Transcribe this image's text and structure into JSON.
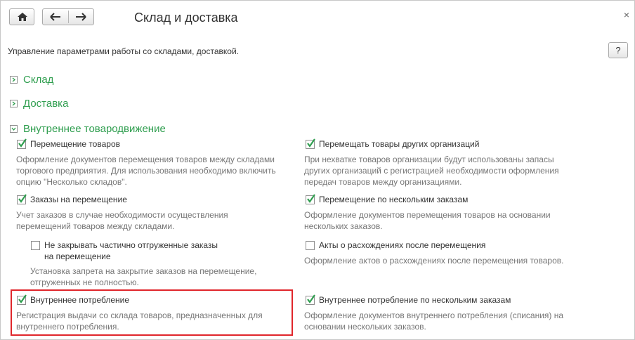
{
  "window": {
    "title": "Склад и доставка",
    "close_glyph": "×",
    "description": "Управление параметрами работы со складами, доставкой.",
    "help_label": "?"
  },
  "toolbar": {
    "home_icon": "home-icon",
    "back_icon": "arrow-left-icon",
    "forward_icon": "arrow-right-icon"
  },
  "groups": [
    {
      "title": "Склад",
      "expanded": false
    },
    {
      "title": "Доставка",
      "expanded": false
    },
    {
      "title": "Внутреннее товародвижение",
      "expanded": true
    }
  ],
  "options": {
    "transfer": {
      "label": "Перемещение товаров",
      "checked": true,
      "note1": "Оформление документов перемещения товаров между складами",
      "note2": "торгового предприятия. Для использования необходимо включить",
      "note3": "опцию \"Несколько складов\"."
    },
    "transfer_orders": {
      "label": "Заказы на перемещение",
      "checked": true,
      "note1": "Учет заказов в случае необходимости осуществления",
      "note2": "перемещений товаров между складами."
    },
    "no_close_orders": {
      "label1": "Не закрывать частично отгруженные заказы",
      "label2": "на перемещение",
      "checked": false,
      "note1": "Установка запрета на закрытие заказов на перемещение,",
      "note2": "отгруженных не полностью."
    },
    "internal_consumption": {
      "label": "Внутреннее потребление",
      "checked": true,
      "note1": "Регистрация выдачи со склада товаров, предназначенных для",
      "note2": "внутреннего потребления."
    },
    "other_orgs": {
      "label": "Перемещать товары других организаций",
      "checked": true,
      "note1": "При нехватке товаров организации будут использованы запасы",
      "note2": "других организаций с регистрацией необходимости оформления",
      "note3": "передач товаров между организациями."
    },
    "multi_orders": {
      "label": "Перемещение по нескольким заказам",
      "checked": true,
      "note1": "Оформление документов перемещения товаров на основании",
      "note2": "нескольких заказов."
    },
    "discrepancy": {
      "label": "Акты о расхождениях после перемещения",
      "checked": false,
      "note1": "Оформление актов о расхождениях после перемещения товаров."
    },
    "internal_multi": {
      "label": "Внутреннее потребление по нескольким заказам",
      "checked": true,
      "note1": "Оформление документов внутреннего потребления (списания) на",
      "note2": "основании нескольких заказов."
    }
  },
  "colors": {
    "group_title": "#2f9e4f",
    "note_text": "#767676",
    "highlight_border": "#e0262b",
    "checkmark": "#2f9e4f"
  }
}
